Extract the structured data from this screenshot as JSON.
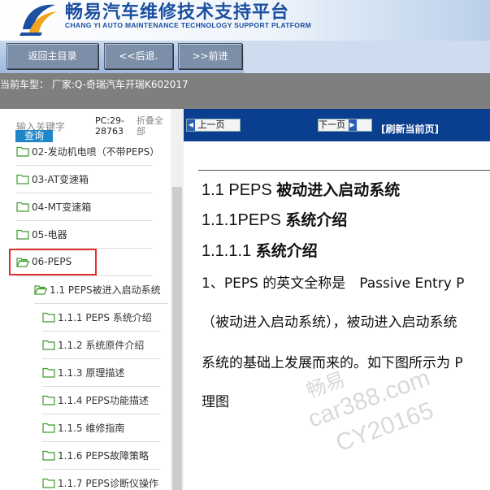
{
  "header": {
    "title_cn": "畅易汽车维修技术支持平台",
    "title_en": "CHANG YI AUTO MAINTENANCE TECHNOLOGY SUPPORT PLATFORM"
  },
  "toolbar": {
    "home_label": "返回主目录",
    "back_label": "<<后退.",
    "forward_label": ">>前进"
  },
  "model_bar": {
    "text": "当前车型： 厂家:Q-奇瑞汽车开瑞K602017"
  },
  "sidebar": {
    "keyword_placeholder": "输入关键字",
    "query_label": "查询",
    "pc_text": "PC:29-28763",
    "fold_label": "折叠全部",
    "tree": [
      {
        "label": "02-发动机电喷（不带PEPS）",
        "level": 0
      },
      {
        "label": "03-AT变速箱",
        "level": 0
      },
      {
        "label": "04-MT变速箱",
        "level": 0
      },
      {
        "label": "05-电器",
        "level": 0
      },
      {
        "label": "06-PEPS",
        "level": 0,
        "selected": true
      },
      {
        "label": "1.1 PEPS被进入启动系统",
        "level": 1
      },
      {
        "label": "1.1.1 PEPS 系统介绍",
        "level": 2
      },
      {
        "label": "1.1.2 系统原件介绍",
        "level": 2
      },
      {
        "label": "1.1.3 原理描述",
        "level": 2
      },
      {
        "label": "1.1.4 PEPS功能描述",
        "level": 2
      },
      {
        "label": "1.1.5 维修指南",
        "level": 2
      },
      {
        "label": "1.1.6 PEPS故障策略",
        "level": 2
      },
      {
        "label": "1.1.7 PEPS诊断仪操作",
        "level": 2
      }
    ]
  },
  "content": {
    "prev_label": "上一页",
    "next_label": "下一页",
    "refresh_label": "[刷新当前页]",
    "heading1_num": "1.1 PEPS",
    "heading1_text": "被动进入启动系统",
    "heading2_num": "1.1.1PEPS",
    "heading2_text": "系统介绍",
    "heading3_num": "1.1.1.1",
    "heading3_text": "系统介绍",
    "para_line1": "1、PEPS 的英文全称是　Passive Entry P",
    "para_line2": "（被动进入启动系统），被动进入启动系统",
    "para_line3": "系统的基础上发展而来的。如下图所示为 P",
    "para_line4": "理图"
  },
  "watermark": {
    "line1": "car388.com",
    "line2": "CY20165",
    "line3": "畅易"
  },
  "colors": {
    "brand_blue": "#1c4fa0",
    "nav_blue": "#0a3f8f",
    "highlight_red": "#e0302c",
    "query_blue": "#1f86c9"
  }
}
